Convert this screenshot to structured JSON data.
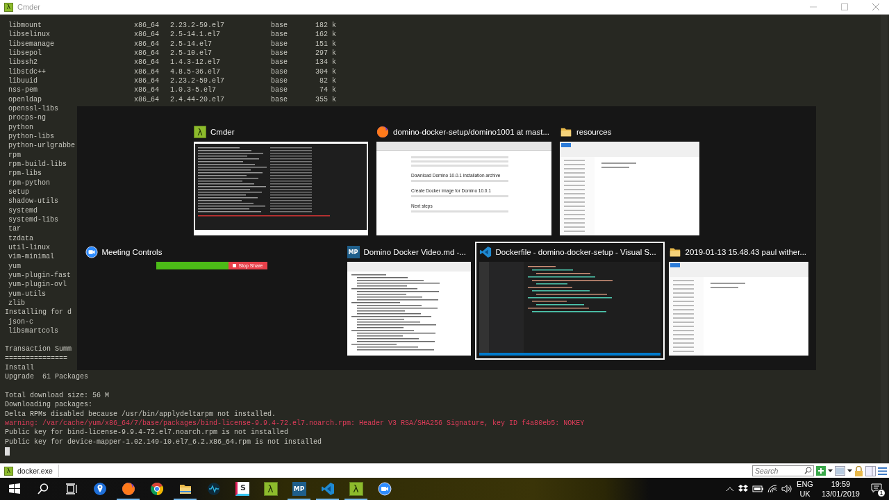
{
  "window": {
    "title": "Cmder",
    "icon_text": "λ"
  },
  "terminal": {
    "lines": [
      {
        "kind": "pkg",
        "cells": [
          "libmount",
          "x86_64",
          "2.23.2-59.el7",
          "base",
          "182 k"
        ]
      },
      {
        "kind": "pkg",
        "cells": [
          "libselinux",
          "x86_64",
          "2.5-14.1.el7",
          "base",
          "162 k"
        ]
      },
      {
        "kind": "pkg",
        "cells": [
          "libsemanage",
          "x86_64",
          "2.5-14.el7",
          "base",
          "151 k"
        ]
      },
      {
        "kind": "pkg",
        "cells": [
          "libsepol",
          "x86_64",
          "2.5-10.el7",
          "base",
          "297 k"
        ]
      },
      {
        "kind": "pkg",
        "cells": [
          "libssh2",
          "x86_64",
          "1.4.3-12.el7",
          "base",
          "134 k"
        ]
      },
      {
        "kind": "pkg",
        "cells": [
          "libstdc++",
          "x86_64",
          "4.8.5-36.el7",
          "base",
          "304 k"
        ]
      },
      {
        "kind": "pkg",
        "cells": [
          "libuuid",
          "x86_64",
          "2.23.2-59.el7",
          "base",
          "82 k"
        ]
      },
      {
        "kind": "pkg",
        "cells": [
          "nss-pem",
          "x86_64",
          "1.0.3-5.el7",
          "base",
          "74 k"
        ]
      },
      {
        "kind": "pkg",
        "cells": [
          "openldap",
          "x86_64",
          "2.4.44-20.el7",
          "base",
          "355 k"
        ]
      },
      {
        "kind": "pkg",
        "cells": [
          "openssl-libs"
        ]
      },
      {
        "kind": "pkg",
        "cells": [
          "procps-ng"
        ]
      },
      {
        "kind": "pkg",
        "cells": [
          "python"
        ]
      },
      {
        "kind": "pkg",
        "cells": [
          "python-libs"
        ]
      },
      {
        "kind": "pkg",
        "cells": [
          "python-urlgrabbe"
        ]
      },
      {
        "kind": "pkg",
        "cells": [
          "rpm"
        ]
      },
      {
        "kind": "pkg",
        "cells": [
          "rpm-build-libs"
        ]
      },
      {
        "kind": "pkg",
        "cells": [
          "rpm-libs"
        ]
      },
      {
        "kind": "pkg",
        "cells": [
          "rpm-python"
        ]
      },
      {
        "kind": "pkg",
        "cells": [
          "setup"
        ]
      },
      {
        "kind": "pkg",
        "cells": [
          "shadow-utils"
        ]
      },
      {
        "kind": "pkg",
        "cells": [
          "systemd"
        ]
      },
      {
        "kind": "pkg",
        "cells": [
          "systemd-libs"
        ]
      },
      {
        "kind": "pkg",
        "cells": [
          "tar"
        ]
      },
      {
        "kind": "pkg",
        "cells": [
          "tzdata"
        ]
      },
      {
        "kind": "pkg",
        "cells": [
          "util-linux"
        ]
      },
      {
        "kind": "pkg",
        "cells": [
          "vim-minimal"
        ]
      },
      {
        "kind": "pkg",
        "cells": [
          "yum"
        ]
      },
      {
        "kind": "pkg",
        "cells": [
          "yum-plugin-fast"
        ]
      },
      {
        "kind": "pkg",
        "cells": [
          "yum-plugin-ovl"
        ]
      },
      {
        "kind": "pkg",
        "cells": [
          "yum-utils"
        ]
      },
      {
        "kind": "pkg",
        "cells": [
          "zlib"
        ]
      },
      {
        "kind": "text",
        "text": "Installing for d"
      },
      {
        "kind": "pkg",
        "cells": [
          "json-c"
        ]
      },
      {
        "kind": "pkg",
        "cells": [
          "libsmartcols"
        ]
      },
      {
        "kind": "blank"
      },
      {
        "kind": "text",
        "text": "Transaction Summ"
      },
      {
        "kind": "text",
        "text": "==============="
      },
      {
        "kind": "text",
        "text": "Install"
      },
      {
        "kind": "text",
        "text": "Upgrade  61 Packages"
      },
      {
        "kind": "blank"
      },
      {
        "kind": "text",
        "text": "Total download size: 56 M"
      },
      {
        "kind": "text",
        "text": "Downloading packages:"
      },
      {
        "kind": "text",
        "text": "Delta RPMs disabled because /usr/bin/applydeltarpm not installed."
      },
      {
        "kind": "warning",
        "text": "warning: /var/cache/yum/x86_64/7/base/packages/bind-license-9.9.4-72.el7.noarch.rpm: Header V3 RSA/SHA256 Signature, key ID f4a80eb5: NOKEY"
      },
      {
        "kind": "text",
        "text": "Public key for bind-license-9.9.4-72.el7.noarch.rpm is not installed"
      },
      {
        "kind": "text",
        "text": "Public key for device-mapper-1.02.149-10.el7_6.2.x86_64.rpm is not installed"
      },
      {
        "kind": "cursor"
      }
    ]
  },
  "switcher": {
    "rows": [
      [
        {
          "title": "Cmder",
          "kind": "cmder",
          "icon_text": "λ",
          "selected": false,
          "thumbnail": {
            "kind": "terminal"
          }
        },
        {
          "title": "domino-docker-setup/domino1001 at mast...",
          "kind": "firefox",
          "selected": false,
          "thumbnail": {
            "kind": "browser",
            "texts": [
              "Download Domino 10.0.1 installation archive",
              "Create Docker image for Domino 10.0.1",
              "Next steps"
            ]
          }
        },
        {
          "title": "resources",
          "kind": "folder",
          "selected": false,
          "thumbnail": {
            "kind": "explorer"
          }
        }
      ],
      [
        {
          "title": "Meeting Controls",
          "kind": "zoom",
          "selected": false,
          "thumbnail": {
            "kind": "meeting-bar",
            "texts": [
              "Stop Share"
            ]
          }
        },
        {
          "title": "Domino Docker Video.md -...",
          "kind": "mp",
          "icon_text": "MP",
          "selected": false,
          "thumbnail": {
            "kind": "editor-light"
          }
        },
        {
          "title": "Dockerfile - domino-docker-setup - Visual S...",
          "kind": "vscode",
          "selected": true,
          "thumbnail": {
            "kind": "editor-dark"
          }
        },
        {
          "title": "2019-01-13 15.48.43 paul wither...",
          "kind": "folder",
          "selected": false,
          "thumbnail": {
            "kind": "explorer"
          }
        }
      ]
    ]
  },
  "status_bar": {
    "tab": {
      "label": "docker.exe",
      "icon_text": "λ"
    },
    "search": {
      "placeholder": "Search"
    }
  },
  "taskbar": {
    "items": [
      {
        "kind": "start",
        "running": false
      },
      {
        "kind": "search",
        "running": false
      },
      {
        "kind": "task-view",
        "running": false
      },
      {
        "kind": "pin",
        "running": false
      },
      {
        "kind": "firefox",
        "running": true
      },
      {
        "kind": "chrome",
        "running": false
      },
      {
        "kind": "explorer",
        "running": true
      },
      {
        "kind": "wave",
        "running": false
      },
      {
        "kind": "slack",
        "icon_text": "S",
        "running": false
      },
      {
        "kind": "cmder",
        "icon_text": "λ",
        "running": false
      },
      {
        "kind": "mp",
        "icon_text": "MP",
        "running": true
      },
      {
        "kind": "vscode",
        "running": true
      },
      {
        "kind": "cmder2",
        "icon_text": "λ",
        "running": true
      },
      {
        "kind": "zoom",
        "running": false
      }
    ],
    "tray": {
      "language": [
        "ENG",
        "UK"
      ],
      "time": "19:59",
      "date": "13/01/2019",
      "notifications": "1"
    }
  }
}
